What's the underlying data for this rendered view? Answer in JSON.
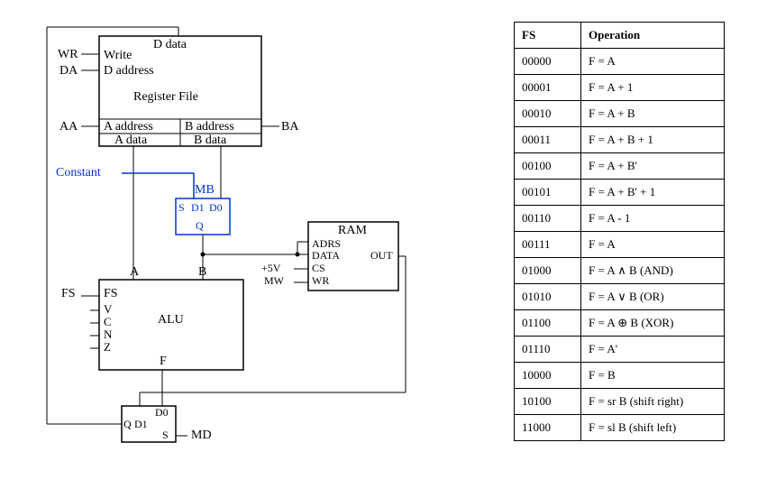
{
  "diagram": {
    "regfile": {
      "title": "Register File",
      "d_data": "D data",
      "write": "Write",
      "d_address": "D address",
      "a_address": "A address",
      "b_address": "B address",
      "a_data": "A data",
      "b_data": "B data"
    },
    "ext_labels": {
      "WR": "WR",
      "DA": "DA",
      "AA": "AA",
      "BA": "BA",
      "Constant": "Constant"
    },
    "mux_mb": {
      "name": "MB",
      "s": "S",
      "d1": "D1",
      "d0": "D0",
      "q": "Q"
    },
    "alu": {
      "name": "ALU",
      "A": "A",
      "B": "B",
      "F": "F",
      "FS": "FS",
      "V": "V",
      "C": "C",
      "N": "N",
      "Z": "Z"
    },
    "ext_fs": "FS",
    "ram": {
      "name": "RAM",
      "ADRS": "ADRS",
      "DATA": "DATA",
      "CS": "CS",
      "WR": "WR",
      "OUT": "OUT",
      "five_v": "+5V",
      "MW": "MW"
    },
    "mux_md": {
      "name": "MD",
      "s": "S",
      "d1": "D1",
      "d0": "D0",
      "q": "Q"
    }
  },
  "table": {
    "headers": {
      "fs": "FS",
      "op": "Operation"
    },
    "rows": [
      {
        "fs": "00000",
        "op": "F = A"
      },
      {
        "fs": "00001",
        "op": "F = A + 1"
      },
      {
        "fs": "00010",
        "op": "F = A + B"
      },
      {
        "fs": "00011",
        "op": "F = A + B + 1"
      },
      {
        "fs": "00100",
        "op": "F = A + B'"
      },
      {
        "fs": "00101",
        "op": "F = A + B' + 1"
      },
      {
        "fs": "00110",
        "op": "F = A - 1"
      },
      {
        "fs": "00111",
        "op": "F = A"
      },
      {
        "fs": "01000",
        "op": "F = A ∧ B (AND)"
      },
      {
        "fs": "01010",
        "op": "F = A ∨ B (OR)"
      },
      {
        "fs": "01100",
        "op": "F = A ⊕ B (XOR)"
      },
      {
        "fs": "01110",
        "op": "F = A'"
      },
      {
        "fs": "10000",
        "op": "F = B"
      },
      {
        "fs": "10100",
        "op": "F = sr B (shift right)"
      },
      {
        "fs": "11000",
        "op": "F = sl B (shift left)"
      }
    ]
  }
}
